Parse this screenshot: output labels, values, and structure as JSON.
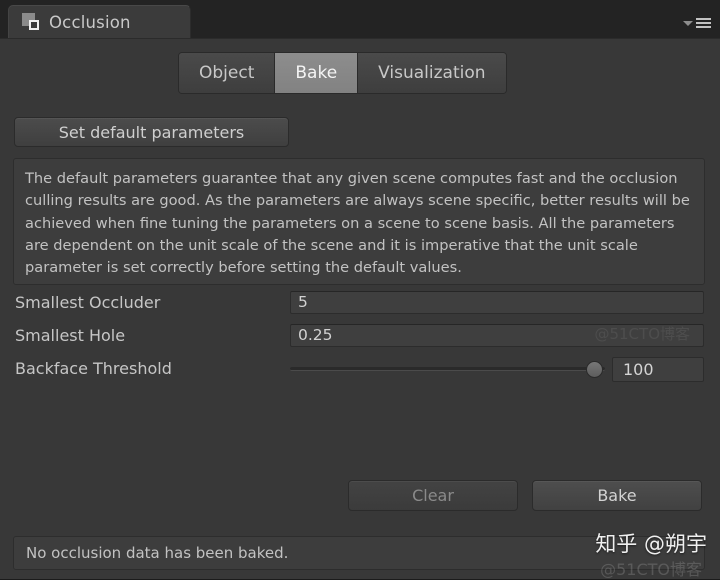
{
  "window": {
    "title": "Occlusion",
    "icon": "occlusion-window-icon",
    "menu_icon": "panel-menu-icon"
  },
  "tabs": [
    {
      "label": "Object",
      "active": false
    },
    {
      "label": "Bake",
      "active": true
    },
    {
      "label": "Visualization",
      "active": false
    }
  ],
  "toolbar": {
    "set_default_label": "Set default parameters"
  },
  "help": {
    "text": "The default parameters guarantee that any given scene computes fast and the occlusion culling results are good. As the parameters are always scene specific, better results will be achieved when fine tuning the parameters on a scene to scene basis. All the parameters are dependent on the unit scale of the scene and it is imperative that the unit scale parameter is set correctly before setting the default values."
  },
  "parameters": {
    "smallest_occluder": {
      "label": "Smallest Occluder",
      "value": "5"
    },
    "smallest_hole": {
      "label": "Smallest Hole",
      "value": "0.25"
    },
    "backface_threshold": {
      "label": "Backface Threshold",
      "value": "100",
      "slider_percent": 100,
      "min": 0,
      "max": 100
    }
  },
  "actions": {
    "clear_label": "Clear",
    "clear_enabled": false,
    "bake_label": "Bake",
    "bake_enabled": true
  },
  "status": {
    "message": "No occlusion data has been baked."
  },
  "watermarks": {
    "main": "知乎 @朔宇",
    "sub": "@51CTO博客",
    "mid": "@51CTO博客"
  },
  "colors": {
    "panel_background": "#383838",
    "titlebar_background": "#232323",
    "tab_active": "#8d8d8d",
    "field_background": "#3f3f3f",
    "text_primary": "#c6c6c6",
    "text_disabled": "#8a8a8a"
  }
}
